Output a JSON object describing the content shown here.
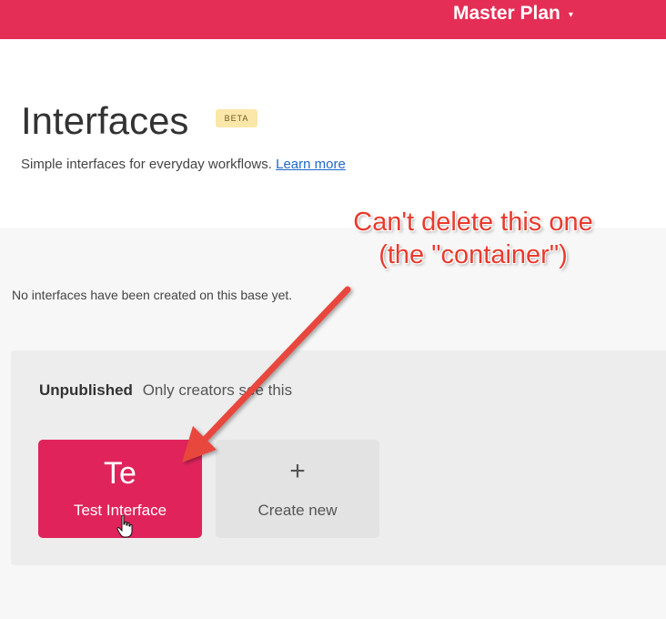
{
  "topbar": {
    "base_name": "Master Plan",
    "caret": "▾",
    "color": "#e52e56"
  },
  "header": {
    "title": "Interfaces",
    "badge": "BETA",
    "subtitle": "Simple interfaces for everyday workflows.",
    "learn_more": "Learn more"
  },
  "main": {
    "empty_message": "No interfaces have been created on this base yet."
  },
  "section": {
    "label": "Unpublished",
    "description": "Only creators see this",
    "interfaces": [
      {
        "abbr": "Te",
        "name": "Test Interface",
        "color": "#e0245b"
      }
    ],
    "create": {
      "icon": "+",
      "label": "Create new"
    }
  },
  "annotation": {
    "line1": "Can't delete this one",
    "line2": "(the \"container\")",
    "color": "#e83a2e"
  },
  "icons": [
    "caret-down-icon",
    "plus-icon",
    "hand-cursor-icon",
    "arrow-icon"
  ]
}
